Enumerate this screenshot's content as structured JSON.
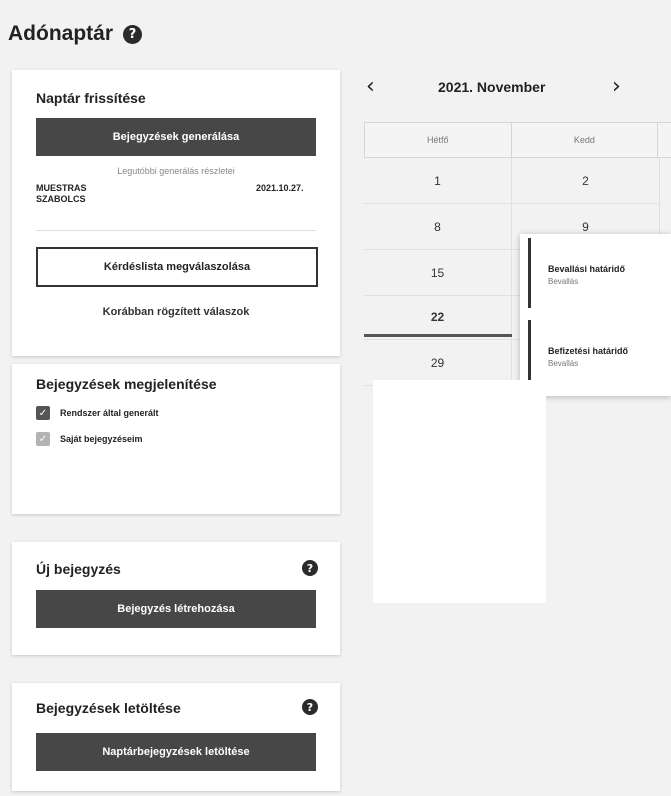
{
  "page": {
    "title": "Adónaptár"
  },
  "refresh_card": {
    "title": "Naptár frissítése",
    "generate_button": "Bejegyzések generálása",
    "last_generation_label": "Legutóbbi generálás részletei",
    "user_name_line1": "MUESTRAS",
    "user_name_line2": "SZABOLCS",
    "generation_date": "2021.10.27.",
    "questionnaire_button": "Kérdéslista megválaszolása",
    "previous_answers_link": "Korábban rögzített válaszok"
  },
  "display_card": {
    "title": "Bejegyzések megjelenítése",
    "options": [
      {
        "label": "Rendszer által generált",
        "checked": true
      },
      {
        "label": "Saját bejegyzéseim",
        "checked": false
      }
    ]
  },
  "new_entry_card": {
    "title": "Új bejegyzés",
    "create_button": "Bejegyzés létrehozása"
  },
  "download_card": {
    "title": "Bejegyzések letöltése",
    "download_button": "Naptárbejegyzések letöltése"
  },
  "calendar": {
    "month_label": "2021. November",
    "prev_icon": "chevron-left-icon",
    "next_icon": "chevron-right-icon",
    "weekdays": [
      "Hétfő",
      "Kedd"
    ],
    "rows": [
      [
        "1",
        "2"
      ],
      [
        "8",
        "9"
      ],
      [
        "15",
        ""
      ],
      [
        "22",
        ""
      ],
      [
        "29",
        ""
      ]
    ],
    "today": "22",
    "events": [
      {
        "title": "Bevallási határidő",
        "type": "Bevallás"
      },
      {
        "title": "Befizetési határidő",
        "type": "Bevallás"
      }
    ]
  },
  "colors": {
    "dark_button": "#474747",
    "background": "#f2f2f2"
  }
}
